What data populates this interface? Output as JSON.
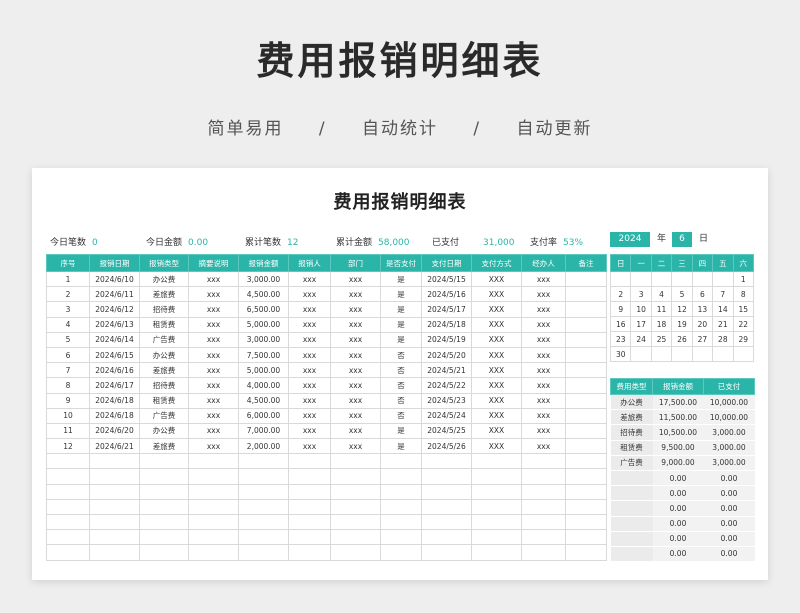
{
  "page": {
    "title": "费用报销明细表",
    "subtitles": [
      "简单易用",
      "/",
      "自动统计",
      "/",
      "自动更新"
    ]
  },
  "sheet": {
    "title": "费用报销明细表",
    "stats": [
      {
        "label": "今日笔数",
        "value": "0"
      },
      {
        "label": "今日金额",
        "value": "0.00"
      },
      {
        "label": "累计笔数",
        "value": "12"
      },
      {
        "label": "累计金额",
        "value": "58,000"
      },
      {
        "label": "已支付",
        "value": "31,000"
      },
      {
        "label": "支付率",
        "value": "53%"
      }
    ],
    "columns": [
      "序号",
      "报销日期",
      "报销类型",
      "摘要说明",
      "报销金额",
      "报销人",
      "部门",
      "是否支付",
      "支付日期",
      "支付方式",
      "经办人",
      "备注"
    ],
    "rows": [
      [
        "1",
        "2024/6/10",
        "办公费",
        "xxx",
        "3,000.00",
        "xxx",
        "xxx",
        "是",
        "2024/5/15",
        "XXX",
        "xxx",
        ""
      ],
      [
        "2",
        "2024/6/11",
        "差旅费",
        "xxx",
        "4,500.00",
        "xxx",
        "xxx",
        "是",
        "2024/5/16",
        "XXX",
        "xxx",
        ""
      ],
      [
        "3",
        "2024/6/12",
        "招待费",
        "xxx",
        "6,500.00",
        "xxx",
        "xxx",
        "是",
        "2024/5/17",
        "XXX",
        "xxx",
        ""
      ],
      [
        "4",
        "2024/6/13",
        "租赁费",
        "xxx",
        "5,000.00",
        "xxx",
        "xxx",
        "是",
        "2024/5/18",
        "XXX",
        "xxx",
        ""
      ],
      [
        "5",
        "2024/6/14",
        "广告费",
        "xxx",
        "3,000.00",
        "xxx",
        "xxx",
        "是",
        "2024/5/19",
        "XXX",
        "xxx",
        ""
      ],
      [
        "6",
        "2024/6/15",
        "办公费",
        "xxx",
        "7,500.00",
        "xxx",
        "xxx",
        "否",
        "2024/5/20",
        "XXX",
        "xxx",
        ""
      ],
      [
        "7",
        "2024/6/16",
        "差旅费",
        "xxx",
        "5,000.00",
        "xxx",
        "xxx",
        "否",
        "2024/5/21",
        "XXX",
        "xxx",
        ""
      ],
      [
        "8",
        "2024/6/17",
        "招待费",
        "xxx",
        "4,000.00",
        "xxx",
        "xxx",
        "否",
        "2024/5/22",
        "XXX",
        "xxx",
        ""
      ],
      [
        "9",
        "2024/6/18",
        "租赁费",
        "xxx",
        "4,500.00",
        "xxx",
        "xxx",
        "否",
        "2024/5/23",
        "XXX",
        "xxx",
        ""
      ],
      [
        "10",
        "2024/6/18",
        "广告费",
        "xxx",
        "6,000.00",
        "xxx",
        "xxx",
        "否",
        "2024/5/24",
        "XXX",
        "xxx",
        ""
      ],
      [
        "11",
        "2024/6/20",
        "办公费",
        "xxx",
        "7,000.00",
        "xxx",
        "xxx",
        "是",
        "2024/5/25",
        "XXX",
        "xxx",
        ""
      ],
      [
        "12",
        "2024/6/21",
        "差旅费",
        "xxx",
        "2,000.00",
        "xxx",
        "xxx",
        "是",
        "2024/5/26",
        "XXX",
        "xxx",
        ""
      ]
    ],
    "empty_rows": 7
  },
  "calendar": {
    "year": "2024",
    "year_label": "年",
    "month": "6",
    "month_label": "日",
    "weekdays": [
      "日",
      "一",
      "二",
      "三",
      "四",
      "五",
      "六"
    ],
    "weeks": [
      [
        "",
        "",
        "",
        "",
        "",
        "",
        "1"
      ],
      [
        "2",
        "3",
        "4",
        "5",
        "6",
        "7",
        "8"
      ],
      [
        "9",
        "10",
        "11",
        "12",
        "13",
        "14",
        "15"
      ],
      [
        "16",
        "17",
        "18",
        "19",
        "20",
        "21",
        "22"
      ],
      [
        "23",
        "24",
        "25",
        "26",
        "27",
        "28",
        "29"
      ],
      [
        "30",
        "",
        "",
        "",
        "",
        "",
        ""
      ]
    ]
  },
  "summary": {
    "columns": [
      "费用类型",
      "报销金额",
      "已支付"
    ],
    "rows": [
      [
        "办公费",
        "17,500.00",
        "10,000.00"
      ],
      [
        "差旅费",
        "11,500.00",
        "10,000.00"
      ],
      [
        "招待费",
        "10,500.00",
        "3,000.00"
      ],
      [
        "租赁费",
        "9,500.00",
        "3,000.00"
      ],
      [
        "广告费",
        "9,000.00",
        "3,000.00"
      ],
      [
        "",
        "0.00",
        "0.00"
      ],
      [
        "",
        "0.00",
        "0.00"
      ],
      [
        "",
        "0.00",
        "0.00"
      ],
      [
        "",
        "0.00",
        "0.00"
      ],
      [
        "",
        "0.00",
        "0.00"
      ],
      [
        "",
        "0.00",
        "0.00"
      ]
    ]
  },
  "colors": {
    "accent": "#2bb4a8",
    "accent_text": "#2bb4a8"
  }
}
